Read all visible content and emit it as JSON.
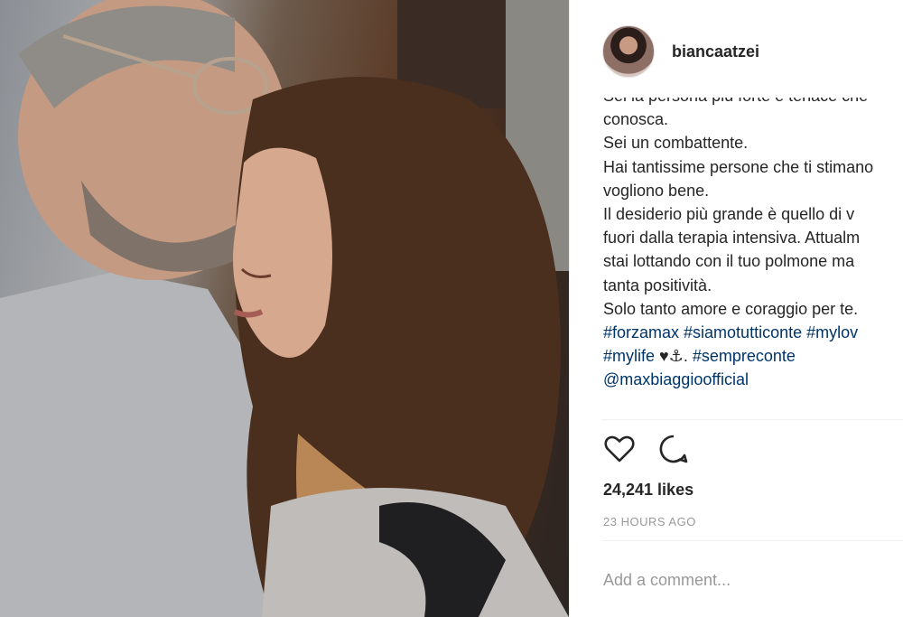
{
  "post": {
    "username": "biancaatzei",
    "caption_lines": [
      "Sei la persona più forte e tenace che",
      "conosca.",
      "Sei un combattente.",
      "Hai tantissime persone che ti stimano",
      "vogliono bene.",
      "Il desiderio più grande è quello di v",
      "fuori dalla terapia intensiva. Attualm",
      "stai lottando con il tuo polmone ma",
      "tanta positività.",
      "Solo tanto amore e coraggio per te."
    ],
    "hashtags_line1": "#forzamax #siamotutticonte #mylov",
    "hashtags_line2": "#mylife",
    "emoji": "♥⚓.",
    "hashtags_line2_tail": "#sempreconte",
    "mention": "@maxbiaggioofficial",
    "likes": "24,241 likes",
    "time": "23 HOURS AGO",
    "comment_placeholder": "Add a comment..."
  },
  "icons": {
    "like": "heart-outline-icon",
    "comment": "speech-bubble-icon"
  },
  "colors": {
    "text": "#262626",
    "link": "#003569",
    "muted": "#999999",
    "divider": "#efefef"
  }
}
